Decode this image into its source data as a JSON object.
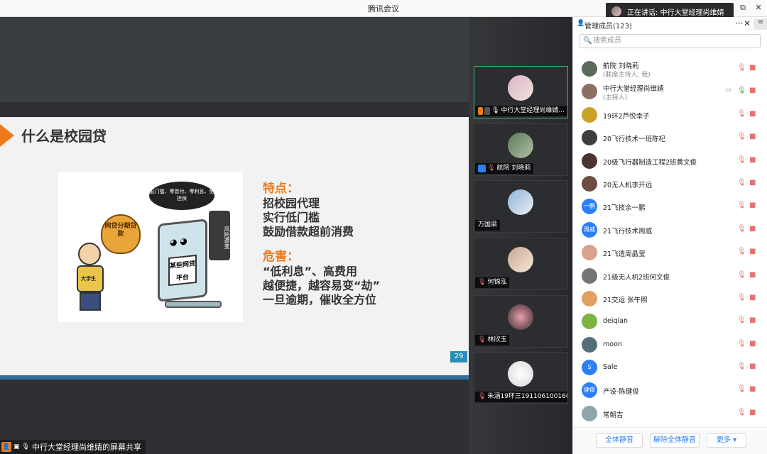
{
  "window": {
    "title": "腾讯会议",
    "speaking": "正在讲话: 中行大堂经理尚维婧"
  },
  "window_controls": {
    "restore": "⧉",
    "close": "✕"
  },
  "slide": {
    "heading": "什么是校园贷",
    "bubble": "低门槛、零首付、零利息、免担保",
    "bag_text": "网贷分期贷款",
    "person_tag": "大学生",
    "monitor_text": "某些网贷平台",
    "board_text": "风险遭变",
    "features_title": "特点：",
    "features": [
      "招校园代理",
      "实行低门槛",
      "鼓励借款超前消费"
    ],
    "harms_title": "危害：",
    "harms": [
      "“低利息”、高费用",
      "越便捷，越容易变“劫”",
      "一旦逾期，催收全方位"
    ],
    "page": "29"
  },
  "share_label": "中行大堂经理尚维婧的屏幕共享",
  "video_tiles": [
    {
      "name": "中行大堂经理尚维婧...",
      "active": true
    },
    {
      "name": "航院 刘晓莉",
      "active": false
    },
    {
      "name": "万国梁",
      "active": false
    },
    {
      "name": "何锦泓",
      "active": false
    },
    {
      "name": "林欣玉",
      "active": false
    },
    {
      "name": "朱涵19环三191106100160",
      "active": false
    }
  ],
  "panel": {
    "title": "管理成员(123)",
    "more": "···",
    "close": "✕",
    "menu": "≡",
    "search_placeholder": "搜索成员",
    "members": [
      {
        "name": "航院 刘晓莉",
        "role": "(联席主持人, 我)",
        "avatar_color": "#5b6b5b",
        "avatar_text": ""
      },
      {
        "name": "中行大堂经理尚维婧",
        "role": "(主持人)",
        "avatar_color": "#8d6e63",
        "avatar_text": "",
        "mic_on": true
      },
      {
        "name": "19环2芦悦幸子",
        "role": "",
        "avatar_color": "#c9a227",
        "avatar_text": ""
      },
      {
        "name": "20飞行技术一班陈杞",
        "role": "",
        "avatar_color": "#3e3e3e",
        "avatar_text": ""
      },
      {
        "name": "20级飞行器制造工程2班黄文俊",
        "role": "",
        "avatar_color": "#4e342e",
        "avatar_text": ""
      },
      {
        "name": "20无人机李开远",
        "role": "",
        "avatar_color": "#6d4c41",
        "avatar_text": ""
      },
      {
        "name": "21飞技余一鹏",
        "role": "",
        "avatar_color": "#2d7ff9",
        "avatar_text": "一鹏"
      },
      {
        "name": "21飞行技术周威",
        "role": "",
        "avatar_color": "#2d7ff9",
        "avatar_text": "周威"
      },
      {
        "name": "21飞造周晶莹",
        "role": "",
        "avatar_color": "#d7a38c",
        "avatar_text": ""
      },
      {
        "name": "21级无人机2班何文俊",
        "role": "",
        "avatar_color": "#757575",
        "avatar_text": ""
      },
      {
        "name": "21交运 张午照",
        "role": "",
        "avatar_color": "#e0a060",
        "avatar_text": ""
      },
      {
        "name": "deiqian",
        "role": "",
        "avatar_color": "#7cb342",
        "avatar_text": ""
      },
      {
        "name": "moon",
        "role": "",
        "avatar_color": "#546e7a",
        "avatar_text": ""
      },
      {
        "name": "Sale",
        "role": "",
        "avatar_color": "#2d7ff9",
        "avatar_text": "S"
      },
      {
        "name": "产设-陈健俊",
        "role": "",
        "avatar_color": "#2d7ff9",
        "avatar_text": "健俊"
      },
      {
        "name": "常朝吉",
        "role": "",
        "avatar_color": "#90a4ae",
        "avatar_text": ""
      }
    ],
    "footer": {
      "mute_all": "全体静音",
      "unmute_all": "解除全体静音",
      "more": "更多 ▾"
    }
  },
  "colors": {
    "accent": "#2d7ff9",
    "orange": "#ef7a1a",
    "active_border": "#3cb371"
  }
}
